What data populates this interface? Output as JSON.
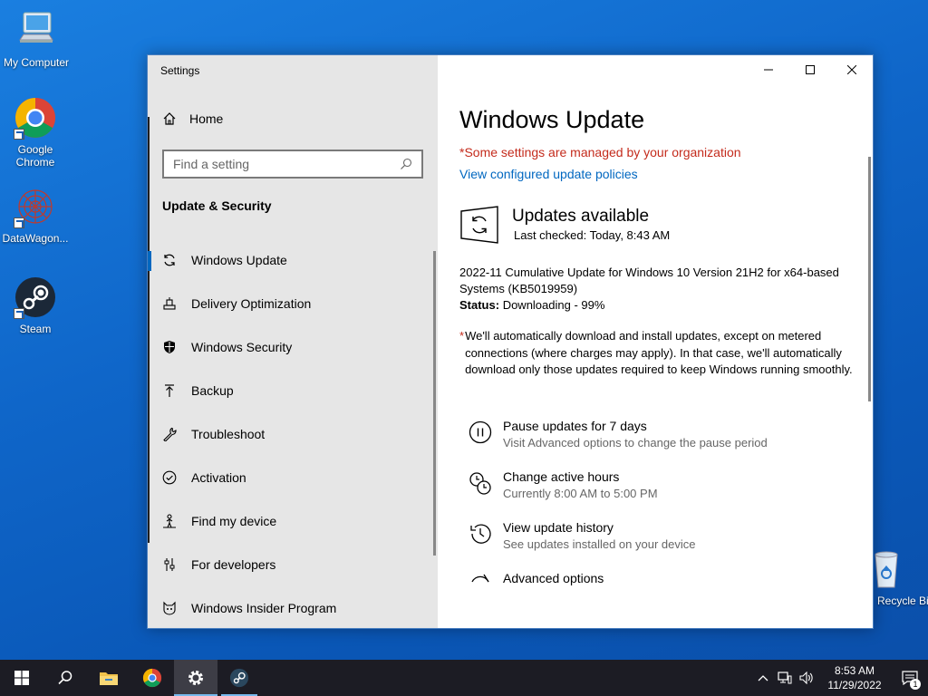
{
  "desktop": {
    "icons": [
      {
        "label": "My Computer"
      },
      {
        "label": "Google Chrome"
      },
      {
        "label": "DataWagon..."
      },
      {
        "label": "Steam"
      },
      {
        "label": "Recycle Bin"
      }
    ]
  },
  "window": {
    "app_title": "Settings",
    "controls": {
      "minimize": "minimize-icon",
      "maximize": "maximize-icon",
      "close": "close-icon"
    }
  },
  "nav": {
    "home_label": "Home",
    "search_placeholder": "Find a setting",
    "section_title": "Update & Security",
    "items": [
      {
        "label": "Windows Update",
        "icon": "sync-icon",
        "active": true
      },
      {
        "label": "Delivery Optimization",
        "icon": "delivery-icon"
      },
      {
        "label": "Windows Security",
        "icon": "shield-icon"
      },
      {
        "label": "Backup",
        "icon": "backup-arrow-icon"
      },
      {
        "label": "Troubleshoot",
        "icon": "wrench-icon"
      },
      {
        "label": "Activation",
        "icon": "check-circle-icon"
      },
      {
        "label": "Find my device",
        "icon": "person-location-icon"
      },
      {
        "label": "For developers",
        "icon": "developer-sliders-icon"
      },
      {
        "label": "Windows Insider Program",
        "icon": "insider-cat-icon"
      }
    ]
  },
  "main": {
    "title": "Windows Update",
    "managed_notice": "*Some settings are managed by your organization",
    "policies_link": "View configured update policies",
    "status_title": "Updates available",
    "last_checked": "Last checked: Today, 8:43 AM",
    "update_name": "2022-11 Cumulative Update for Windows 10 Version 21H2 for x64-based Systems (KB5019959)",
    "status_label": "Status:",
    "status_value": "Downloading - 99%",
    "note_star": "*",
    "note_text": "We'll automatically download and install updates, except on metered connections (where charges may apply). In that case, we'll automatically download only those updates required to keep Windows running smoothly.",
    "options": [
      {
        "title": "Pause updates for 7 days",
        "sub": "Visit Advanced options to change the pause period",
        "icon": "pause-icon"
      },
      {
        "title": "Change active hours",
        "sub": "Currently 8:00 AM to 5:00 PM",
        "icon": "active-hours-icon"
      },
      {
        "title": "View update history",
        "sub": "See updates installed on your device",
        "icon": "history-icon"
      },
      {
        "title": "Advanced options",
        "sub": "",
        "icon": "advanced-sync-icon"
      }
    ]
  },
  "taskbar": {
    "time": "8:53 AM",
    "date": "11/29/2022",
    "notification_count": "1"
  },
  "colors": {
    "accent": "#0067c0",
    "warning": "#c42b1c",
    "nav_bg": "#e6e6e6",
    "taskbar": "#1c1c24"
  }
}
